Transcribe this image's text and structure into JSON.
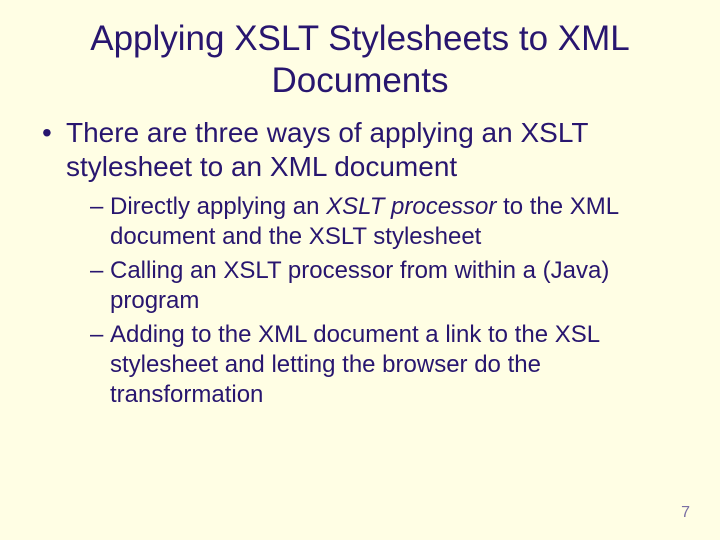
{
  "title": "Applying XSLT Stylesheets to XML Documents",
  "lvl1_item": "There are three ways of applying an XSLT stylesheet to an XML document",
  "lvl2": {
    "a_pre": "Directly applying an ",
    "a_em": "XSLT processor",
    "a_post": " to the XML document and the XSLT stylesheet",
    "b": "Calling an XSLT processor from within a (Java) program",
    "c": "Adding to the XML document a link to the XSL stylesheet and letting the browser do the transformation"
  },
  "page_number": "7"
}
